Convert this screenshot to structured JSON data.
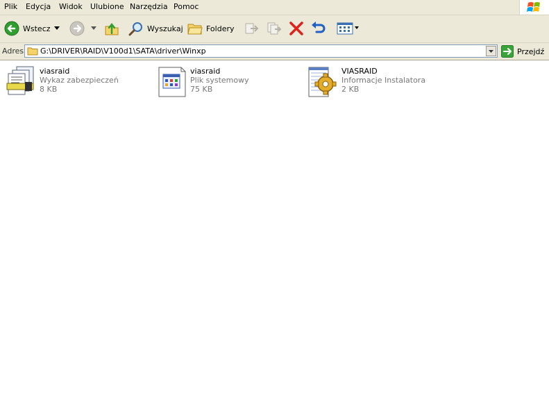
{
  "menu": {
    "items": [
      {
        "id": "file",
        "label": "Plik"
      },
      {
        "id": "edit",
        "label": "Edycja"
      },
      {
        "id": "view",
        "label": "Widok"
      },
      {
        "id": "favorites",
        "label": "Ulubione"
      },
      {
        "id": "tools",
        "label": "Narzędzia"
      },
      {
        "id": "help",
        "label": "Pomoc"
      }
    ]
  },
  "toolbar": {
    "back_label": "Wstecz",
    "search_label": "Wyszukaj",
    "folders_label": "Foldery",
    "icons": [
      "back-arrow-icon",
      "forward-arrow-icon",
      "up-folder-icon",
      "search-magnifier-icon",
      "folders-icon",
      "move-to-icon",
      "copy-to-icon",
      "delete-x-icon",
      "undo-icon",
      "views-icon"
    ]
  },
  "address": {
    "label": "Adres",
    "path": "G:\\DRIVER\\RAID\\V100d1\\SATA\\driver\\Winxp",
    "go_label": "Przejdź"
  },
  "files": [
    {
      "name": "viasraid",
      "type": "Wykaz zabezpieczeń",
      "size": "8 KB",
      "icon": "security-catalog-icon"
    },
    {
      "name": "viasraid",
      "type": "Plik systemowy",
      "size": "75 KB",
      "icon": "system-file-icon"
    },
    {
      "name": "VIASRAID",
      "type": "Informacje Instalatora",
      "size": "2 KB",
      "icon": "setup-information-icon"
    }
  ],
  "colors": {
    "chrome": "#ece9d8",
    "back_green": "#2f9e2f",
    "delete_red": "#e0201b",
    "undo_blue": "#1f5fc6",
    "go_green": "#3aa43a"
  }
}
